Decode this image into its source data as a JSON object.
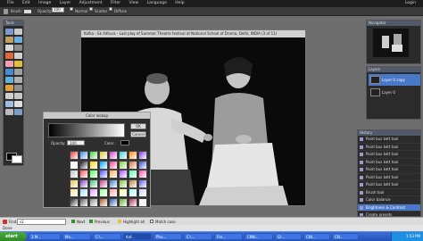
{
  "menubar": {
    "items": [
      "File",
      "Edit",
      "Image",
      "Layer",
      "Adjustment",
      "Filter",
      "View",
      "Language",
      "Help"
    ],
    "login": "Login"
  },
  "options": {
    "brush_label": "Brush:",
    "opacity_label": "Opacity:",
    "opacity_value": "100",
    "mode": "Normal",
    "scatter": "Scatter",
    "diffuse": "Diffuse"
  },
  "tools": {
    "title": "Tools"
  },
  "document": {
    "title": "Kafka - Ek Adhura - Last play of Summer Theatre festival at National School of Drama, Delhi, INDIA (3 of 11)"
  },
  "color_dialog": {
    "title": "Color lookup",
    "ok_label": "OK",
    "cancel_label": "Cancel",
    "opacity_label": "Opacity:",
    "opacity_value": "100",
    "color_label": "Color:"
  },
  "presets": [
    "#e23d3d",
    "#3d8de2",
    "#45d045",
    "#e2c83d",
    "#d03dd0",
    "#3dd0d0",
    "#ff8a00",
    "#8a3de2",
    "#f2f2f2",
    "#1a1a1a",
    "#ffd400",
    "#00a2ff",
    "#ff3d8a",
    "#7ad03d",
    "#d0703d",
    "#3d50d0",
    "#c0c0c0",
    "#ff5050",
    "#50ff50",
    "#5050ff",
    "#ffaa50",
    "#aa50ff",
    "#50ffaa",
    "#ff50aa",
    "#e8c050",
    "#8040c0",
    "#40c080",
    "#c04080",
    "#4080c0",
    "#80c040",
    "#c08040",
    "#6060e0",
    "#ffe0a0",
    "#a0e0ff",
    "#e0a0ff",
    "#a0ffa0",
    "#ffa0a0",
    "#ffffa0",
    "#a0ffff",
    "#d0d0ff",
    "#303030",
    "#606060",
    "#909090",
    "#b06030",
    "#3060b0",
    "#60b030",
    "#b03060",
    "#f0f0f0"
  ],
  "navigator": {
    "title": "Navigator"
  },
  "layers": {
    "title": "Layers",
    "items": [
      "Layer 0 copy",
      "Layer 0"
    ]
  },
  "history": {
    "title": "History",
    "items": [
      "Paint bus kett tool",
      "Paint bus kett tool",
      "Paint bus kett tool",
      "Paint bus kett tool",
      "Paint bus kett tool",
      "Paint bus kett tool",
      "Paint bus kett tool",
      "Brush tool",
      "Color balance",
      "Brightness & Contrast",
      "Create presets"
    ],
    "selected_index": 9
  },
  "findbar": {
    "label": "Find:",
    "value": "s2",
    "next": "Next",
    "previous": "Previous",
    "highlight": "Highlight all",
    "match_case": "Match case"
  },
  "status": {
    "text": "Done"
  },
  "taskbar": {
    "start": "start",
    "items": [
      "3 M...",
      "Mo...",
      "C:\\...",
      "Kaf...",
      "Pho...",
      "C:\\...",
      "Fre...",
      "CNN...",
      "Gr...",
      "CNI...",
      "CN..."
    ],
    "clock": "1:53 PM"
  },
  "colors": {
    "accent": "#4a78c8",
    "taskbar": "#2451b8",
    "start": "#2f8a2a"
  }
}
